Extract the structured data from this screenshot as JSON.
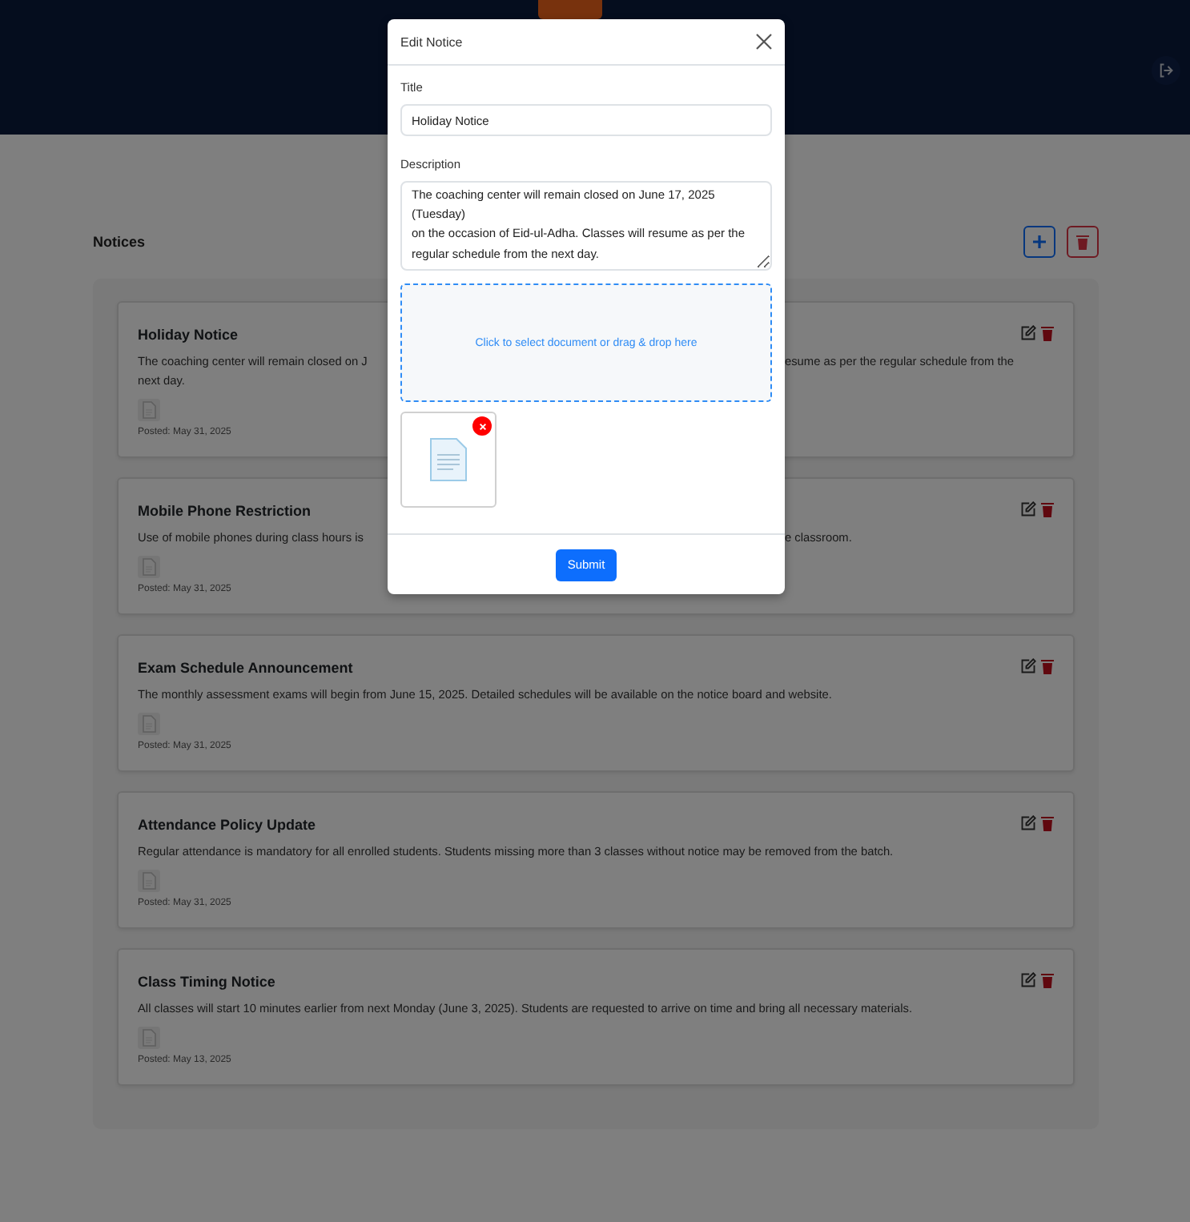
{
  "page": {
    "title": "Notices"
  },
  "notices": [
    {
      "title": "Holiday Notice",
      "lines": [
        {
          "left": "The coaching center will remain closed on J",
          "right": "esume as per the regular schedule from the"
        },
        {
          "left": "next day."
        }
      ],
      "posted": "Posted: May 31, 2025"
    },
    {
      "title": "Mobile Phone Restriction",
      "lines": [
        {
          "left": "Use of mobile phones during class hours is",
          "right": "e classroom."
        }
      ],
      "posted": "Posted: May 31, 2025"
    },
    {
      "title": "Exam Schedule Announcement",
      "description": "The monthly assessment exams will begin from June 15, 2025. Detailed schedules will be available on the notice board and website.",
      "posted": "Posted: May 31, 2025"
    },
    {
      "title": "Attendance Policy Update",
      "description": "Regular attendance is mandatory for all enrolled students. Students missing more than 3 classes without notice may be removed from the batch.",
      "posted": "Posted: May 31, 2025"
    },
    {
      "title": "Class Timing Notice",
      "description": "All classes will start 10 minutes earlier from next Monday (June 3, 2025). Students are requested to arrive on time and bring all necessary materials.",
      "posted": "Posted: May 13, 2025"
    }
  ],
  "modal": {
    "title": "Edit Notice",
    "fields": [
      {
        "kind": "input",
        "label": "Title",
        "value": "Holiday Notice"
      },
      {
        "kind": "textarea",
        "label": "Description",
        "value": "The coaching center will remain closed on June 17, 2025 (Tuesday)\non the occasion of Eid-ul-Adha. Classes will resume as per the regular schedule from the next day."
      }
    ],
    "dropzone": "Click to select document or drag & drop here",
    "attachments": [
      {
        "kind": "document"
      }
    ],
    "submit": "Submit"
  }
}
